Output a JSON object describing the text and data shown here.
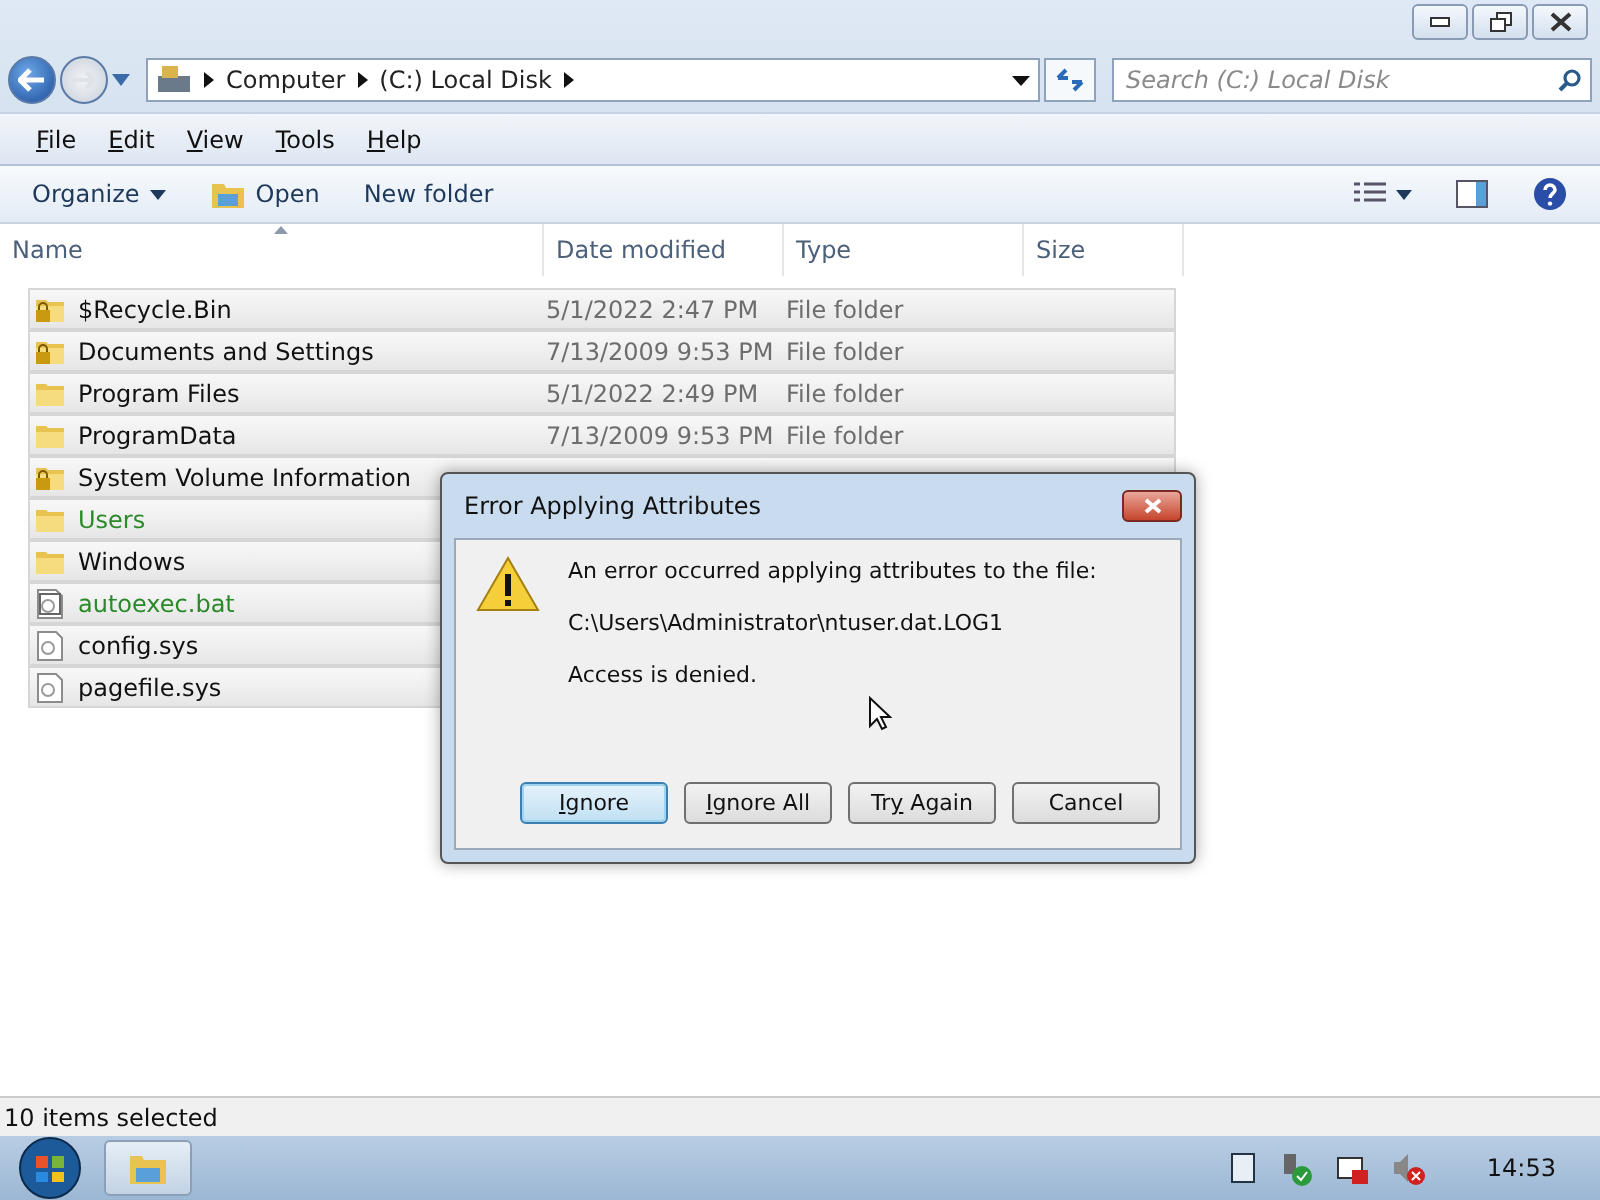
{
  "address": {
    "crumbs": [
      "Computer",
      "(C:) Local Disk"
    ]
  },
  "search": {
    "placeholder": "Search (C:) Local Disk"
  },
  "menu": [
    {
      "hotkey": "F",
      "rest": "ile"
    },
    {
      "hotkey": "E",
      "rest": "dit"
    },
    {
      "hotkey": "V",
      "rest": "iew"
    },
    {
      "hotkey": "T",
      "rest": "ools"
    },
    {
      "hotkey": "H",
      "rest": "elp"
    }
  ],
  "toolbar": {
    "organize": "Organize",
    "open": "Open",
    "new_folder": "New folder"
  },
  "columns": [
    "Name",
    "Date modified",
    "Type",
    "Size"
  ],
  "rows": [
    {
      "name": "$Recycle.Bin",
      "date": "5/1/2022 2:47 PM",
      "type": "File folder",
      "kind": "locked",
      "encrypted": false,
      "selected": true
    },
    {
      "name": "Documents and Settings",
      "date": "7/13/2009 9:53 PM",
      "type": "File folder",
      "kind": "locked",
      "encrypted": false,
      "selected": true
    },
    {
      "name": "Program Files",
      "date": "5/1/2022 2:49 PM",
      "type": "File folder",
      "kind": "folder",
      "encrypted": false,
      "selected": true
    },
    {
      "name": "ProgramData",
      "date": "7/13/2009 9:53 PM",
      "type": "File folder",
      "kind": "folder",
      "encrypted": false,
      "selected": true
    },
    {
      "name": "System Volume Information",
      "kind": "locked",
      "encrypted": false,
      "selected": true
    },
    {
      "name": "Users",
      "kind": "folder",
      "encrypted": true,
      "selected": true
    },
    {
      "name": "Windows",
      "kind": "folder",
      "encrypted": false,
      "selected": true
    },
    {
      "name": "autoexec.bat",
      "kind": "script",
      "encrypted": true,
      "selected": true
    },
    {
      "name": "config.sys",
      "kind": "file",
      "encrypted": false,
      "selected": true
    },
    {
      "name": "pagefile.sys",
      "kind": "file",
      "encrypted": false,
      "selected": true
    }
  ],
  "dialog": {
    "title": "Error Applying Attributes",
    "message": "An error occurred applying attributes to the file:",
    "path": "C:\\Users\\Administrator\\ntuser.dat.LOG1",
    "reason": "Access is denied.",
    "buttons": [
      {
        "hotkey": "I",
        "rest": "gnore",
        "focused": true
      },
      {
        "hotkey": "I",
        "rest": "gnore All",
        "focused": false
      },
      {
        "lead": "Tr",
        "hotkey": "y",
        "rest": " Again",
        "focused": false
      },
      {
        "rest": "Cancel",
        "focused": false
      }
    ]
  },
  "status": "10 items selected",
  "clock": "14:53"
}
